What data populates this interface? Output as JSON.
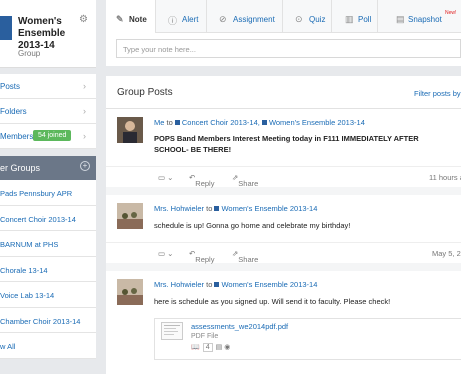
{
  "group": {
    "name": "Women's Ensemble 2013-14",
    "type": "Group"
  },
  "nav": {
    "items": [
      {
        "label": "Posts"
      },
      {
        "label": "Folders"
      },
      {
        "label": "Members",
        "badge": "54 joined"
      }
    ]
  },
  "my_groups": {
    "header": "er Groups",
    "items": [
      "Pads Pennsbury APR",
      "Concert Choir 2013-14",
      "BARNUM at PHS",
      "Chorale 13-14",
      "Voice Lab 13-14",
      "Chamber Choir 2013-14",
      "w All"
    ]
  },
  "composer": {
    "tabs": [
      {
        "label": "Note",
        "icon": "pencil-icon"
      },
      {
        "label": "Alert",
        "icon": "alert-icon"
      },
      {
        "label": "Assignment",
        "icon": "check-circle-icon"
      },
      {
        "label": "Quiz",
        "icon": "quiz-icon"
      },
      {
        "label": "Poll",
        "icon": "poll-icon"
      },
      {
        "label": "Snapshot",
        "icon": "snapshot-icon",
        "badge": "New!"
      }
    ],
    "placeholder": "Type your note here..."
  },
  "feed": {
    "title": "Group Posts",
    "filter_label": "Filter posts by",
    "posts": [
      {
        "sender": "Me",
        "to": "to",
        "recipient1": "Concert Choir 2013-14,",
        "recipient2": "Women's Ensemble 2013-14",
        "text": "POPS Band Members Interest Meeting today in F111 IMMEDIATELY AFTER SCHOOL- BE THERE!",
        "reply": "Reply",
        "share": "Share",
        "time": "11 hours a"
      },
      {
        "sender": "Mrs. Hohwieler",
        "to": "to",
        "recipient1": "Women's Ensemble 2013-14",
        "text": "schedule is up! Gonna go home and celebrate my birthday!",
        "reply": "Reply",
        "share": "Share",
        "time": "May 5, 20"
      },
      {
        "sender": "Mrs. Hohwieler",
        "to": "to",
        "recipient1": "Women's Ensemble 2013-14",
        "text": "here is schedule as you signed up. Will send it to faculty. Please check!",
        "attachment": {
          "file_name": "assessments_we2014pdf.pdf",
          "file_type": "PDF File",
          "count": "4"
        }
      }
    ]
  },
  "colors": {
    "link": "#1a6bb5",
    "badge_green": "#5cb85c",
    "groups_header": "#6b7788",
    "new_badge": "#e02020"
  }
}
